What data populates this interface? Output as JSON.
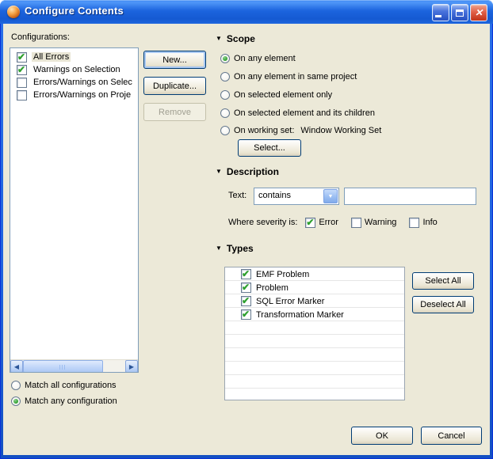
{
  "window": {
    "title": "Configure Contents"
  },
  "icons": {
    "app": "orange-sphere",
    "minimize": "css-bar",
    "maximize": "css-square",
    "close": "✕",
    "collapse": "▼",
    "combo_arrow": "▼",
    "scroll_left": "◀",
    "scroll_right": "▶",
    "check": "✔"
  },
  "configurations": {
    "label": "Configurations:",
    "items": [
      {
        "label": "All Errors",
        "checked": true,
        "selected": true
      },
      {
        "label": "Warnings on Selection",
        "checked": true,
        "selected": false
      },
      {
        "label": "Errors/Warnings on Selec",
        "checked": false,
        "selected": false
      },
      {
        "label": "Errors/Warnings on Proje",
        "checked": false,
        "selected": false
      }
    ],
    "buttons": {
      "new": "New...",
      "duplicate": "Duplicate...",
      "remove": "Remove",
      "remove_disabled": true
    },
    "match": [
      {
        "label": "Match all configurations",
        "selected": false
      },
      {
        "label": "Match any configuration",
        "selected": true
      }
    ]
  },
  "scope": {
    "header": "Scope",
    "options": [
      {
        "label": "On any element",
        "selected": true
      },
      {
        "label": "On any element in same project",
        "selected": false
      },
      {
        "label": "On selected element only",
        "selected": false
      },
      {
        "label": "On selected element and its children",
        "selected": false
      },
      {
        "label": "On working set:",
        "value": "Window Working Set",
        "selected": false
      }
    ],
    "select_button": "Select..."
  },
  "description": {
    "header": "Description",
    "text_label": "Text:",
    "match_mode": "contains",
    "text_value": "",
    "severity_label": "Where severity is:",
    "severities": [
      {
        "label": "Error",
        "checked": true
      },
      {
        "label": "Warning",
        "checked": false
      },
      {
        "label": "Info",
        "checked": false
      }
    ]
  },
  "types": {
    "header": "Types",
    "items": [
      {
        "label": "EMF Problem",
        "checked": true
      },
      {
        "label": "Problem",
        "checked": true
      },
      {
        "label": "SQL Error Marker",
        "checked": true
      },
      {
        "label": "Transformation Marker",
        "checked": true
      }
    ],
    "select_all": "Select All",
    "deselect_all": "Deselect All"
  },
  "footer": {
    "ok": "OK",
    "cancel": "Cancel"
  }
}
